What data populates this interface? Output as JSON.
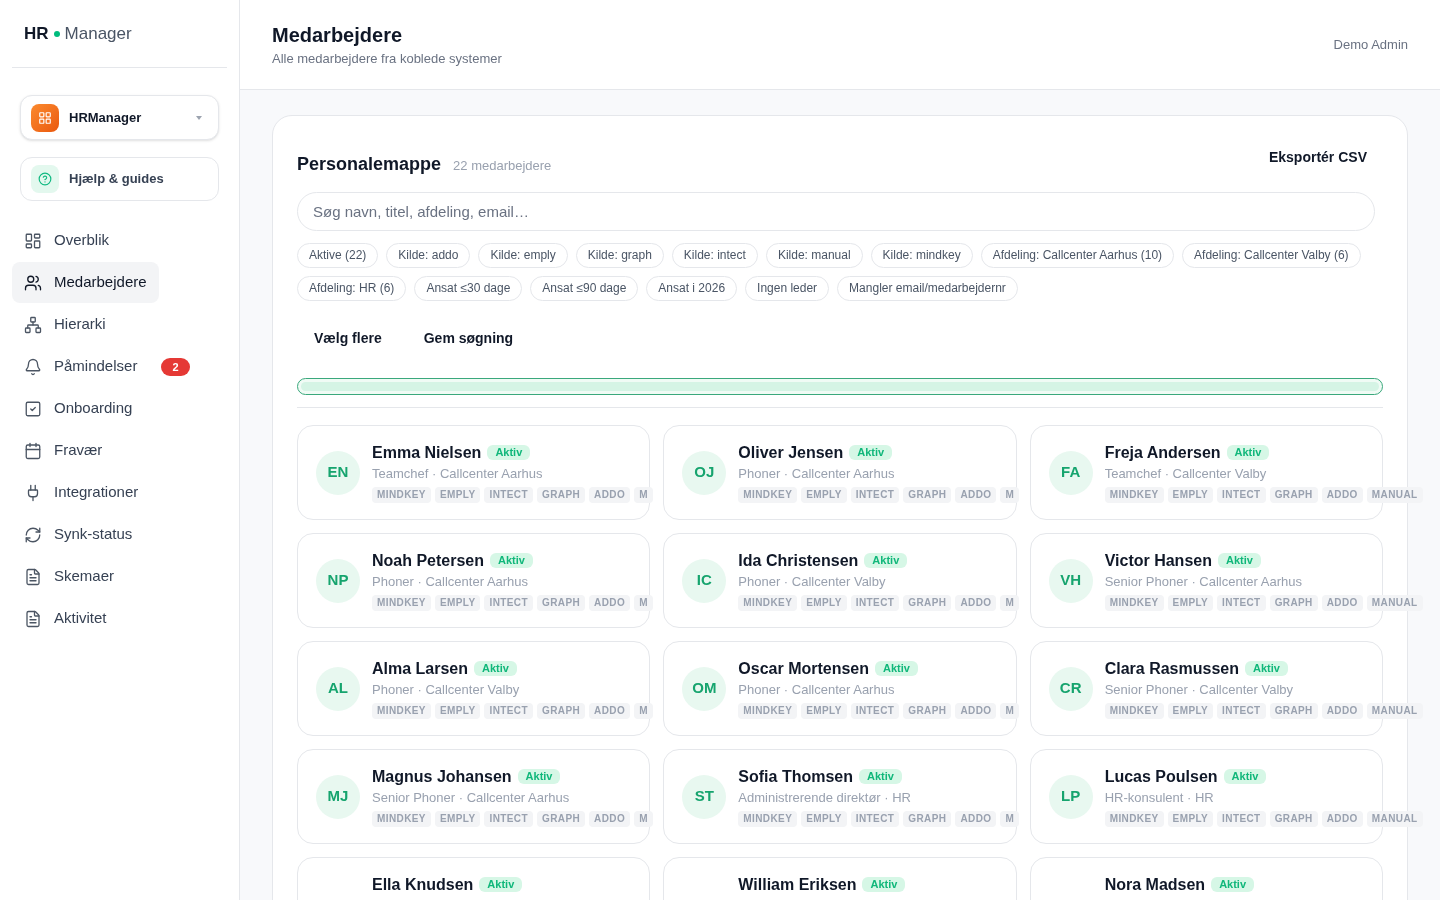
{
  "sidebar": {
    "logo": {
      "bold": "HR",
      "light": "Manager"
    },
    "workspace": {
      "name": "HRManager"
    },
    "help": {
      "label": "Hjælp & guides"
    },
    "nav": [
      {
        "label": "Overblik",
        "selected": false
      },
      {
        "label": "Medarbejdere",
        "selected": true
      },
      {
        "label": "Hierarki",
        "selected": false
      },
      {
        "label": "Påmindelser",
        "selected": false,
        "badge": "2"
      },
      {
        "label": "Onboarding",
        "selected": false
      },
      {
        "label": "Fravær",
        "selected": false
      },
      {
        "label": "Integrationer",
        "selected": false
      },
      {
        "label": "Synk-status",
        "selected": false
      },
      {
        "label": "Skemaer",
        "selected": false
      },
      {
        "label": "Aktivitet",
        "selected": false
      }
    ]
  },
  "header": {
    "title": "Medarbejdere",
    "subtitle": "Alle medarbejdere fra koblede systemer",
    "user": "Demo Admin"
  },
  "directory": {
    "title": "Personalemappe",
    "count": "22 medarbejdere",
    "export_button": "Eksportér CSV",
    "search": {
      "placeholder": "Søg navn, titel, afdeling, email…"
    },
    "filters": [
      {
        "label": "Aktive (22)",
        "selected": false
      },
      {
        "label": "Kilde: addo",
        "selected": false
      },
      {
        "label": "Kilde: emply",
        "selected": false
      },
      {
        "label": "Kilde: graph",
        "selected": false
      },
      {
        "label": "Kilde: intect",
        "selected": false
      },
      {
        "label": "Kilde: manual",
        "selected": false
      },
      {
        "label": "Kilde: mindkey",
        "selected": false
      },
      {
        "label": "Afdeling: Callcenter Aarhus (10)",
        "selected": false
      },
      {
        "label": "Afdeling: Callcenter Valby (6)",
        "selected": false
      },
      {
        "label": "Afdeling: HR (6)",
        "selected": false
      },
      {
        "label": "Ansat ≤30 dage",
        "selected": false
      },
      {
        "label": "Ansat ≤90 dage",
        "selected": false
      },
      {
        "label": "Ansat i 2026",
        "selected": false
      },
      {
        "label": "Ingen leder",
        "selected": false
      },
      {
        "label": "Mangler email/medarbejdernr",
        "selected": false
      }
    ],
    "actions": [
      "Vælg flere",
      "Gem søgning"
    ],
    "progress": {
      "level": 1
    },
    "employees": [
      {
        "initials": "EN",
        "name": "Emma Nielsen",
        "status": "Aktiv",
        "subtitle": "Teamchef · Callcenter Aarhus",
        "tags": [
          "MINDKEY",
          "EMPLY",
          "INTECT",
          "GRAPH",
          "ADDO",
          "M"
        ]
      },
      {
        "initials": "OJ",
        "name": "Oliver Jensen",
        "status": "Aktiv",
        "subtitle": "Phoner · Callcenter Aarhus",
        "tags": [
          "MINDKEY",
          "EMPLY",
          "INTECT",
          "GRAPH",
          "ADDO",
          "M"
        ]
      },
      {
        "initials": "FA",
        "name": "Freja Andersen",
        "status": "Aktiv",
        "subtitle": "Teamchef · Callcenter Valby",
        "tags": [
          "MINDKEY",
          "EMPLY",
          "INTECT",
          "GRAPH",
          "ADDO",
          "MANUAL"
        ]
      },
      {
        "initials": "NP",
        "name": "Noah Petersen",
        "status": "Aktiv",
        "subtitle": "Phoner · Callcenter Aarhus",
        "tags": [
          "MINDKEY",
          "EMPLY",
          "INTECT",
          "GRAPH",
          "ADDO",
          "M"
        ]
      },
      {
        "initials": "IC",
        "name": "Ida Christensen",
        "status": "Aktiv",
        "subtitle": "Phoner · Callcenter Valby",
        "tags": [
          "MINDKEY",
          "EMPLY",
          "INTECT",
          "GRAPH",
          "ADDO",
          "M"
        ]
      },
      {
        "initials": "VH",
        "name": "Victor Hansen",
        "status": "Aktiv",
        "subtitle": "Senior Phoner · Callcenter Aarhus",
        "tags": [
          "MINDKEY",
          "EMPLY",
          "INTECT",
          "GRAPH",
          "ADDO",
          "MANUAL"
        ]
      },
      {
        "initials": "AL",
        "name": "Alma Larsen",
        "status": "Aktiv",
        "subtitle": "Phoner · Callcenter Valby",
        "tags": [
          "MINDKEY",
          "EMPLY",
          "INTECT",
          "GRAPH",
          "ADDO",
          "M"
        ]
      },
      {
        "initials": "OM",
        "name": "Oscar Mortensen",
        "status": "Aktiv",
        "subtitle": "Phoner · Callcenter Aarhus",
        "tags": [
          "MINDKEY",
          "EMPLY",
          "INTECT",
          "GRAPH",
          "ADDO",
          "M"
        ]
      },
      {
        "initials": "CR",
        "name": "Clara Rasmussen",
        "status": "Aktiv",
        "subtitle": "Senior Phoner · Callcenter Valby",
        "tags": [
          "MINDKEY",
          "EMPLY",
          "INTECT",
          "GRAPH",
          "ADDO",
          "MANUAL"
        ]
      },
      {
        "initials": "MJ",
        "name": "Magnus Johansen",
        "status": "Aktiv",
        "subtitle": "Senior Phoner · Callcenter Aarhus",
        "tags": [
          "MINDKEY",
          "EMPLY",
          "INTECT",
          "GRAPH",
          "ADDO",
          "M"
        ]
      },
      {
        "initials": "ST",
        "name": "Sofia Thomsen",
        "status": "Aktiv",
        "subtitle": "Administrerende direktør · HR",
        "tags": [
          "MINDKEY",
          "EMPLY",
          "INTECT",
          "GRAPH",
          "ADDO",
          "M"
        ]
      },
      {
        "initials": "LP",
        "name": "Lucas Poulsen",
        "status": "Aktiv",
        "subtitle": "HR-konsulent · HR",
        "tags": [
          "MINDKEY",
          "EMPLY",
          "INTECT",
          "GRAPH",
          "ADDO",
          "MANUAL"
        ]
      },
      {
        "name": "Ella Knudsen",
        "status": "Aktiv"
      },
      {
        "name": "William Eriksen",
        "status": "Aktiv"
      },
      {
        "name": "Nora Madsen",
        "status": "Aktiv"
      }
    ]
  }
}
